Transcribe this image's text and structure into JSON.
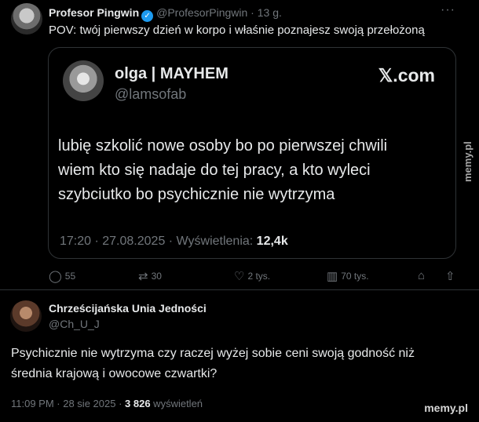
{
  "tweet": {
    "author_name": "Profesor Pingwin",
    "author_handle": "@ProfesorPingwin",
    "separator": "·",
    "age": "13 g.",
    "more_label": "···",
    "text": "POV: twój pierwszy dzień w korpo i właśnie poznajesz swoją przełożoną",
    "verified_icon": "verified-badge-icon",
    "accent_color": "#1d9bf0",
    "quoted": {
      "author_name": "olga | MAYHEM",
      "author_handle": "@lamsofab",
      "source": "𝕏.com",
      "lines": [
        "lubię szkolić nowe osoby bo po pierwszej chwili",
        "wiem kto się nadaje do tej pracy, a kto wyleci",
        "szybciutko bo psychicznie nie wytrzyma"
      ],
      "timestamp": "17:20 · 27.08.2025 · Wyświetlenia: ",
      "views": "12,4k"
    },
    "actions": {
      "replies": "55",
      "retweets": "30",
      "likes": "2 tys.",
      "views": "70 tys."
    }
  },
  "watermark_side": "memy.pl",
  "reply": {
    "author_name": "Chrześcijańska Unia Jedności",
    "author_handle": "@Ch_U_J",
    "text_line1": "Psychicznie nie wytrzyma czy raczej wyżej sobie ceni swoją godność niż",
    "text_line2": "średnia krajową i owocowe czwartki?",
    "timestamp": "11:09 PM · 28 sie 2025 · ",
    "views_count": "3 826",
    "views_label": " wyświetleń"
  },
  "watermark_bottom": "memy.pl"
}
